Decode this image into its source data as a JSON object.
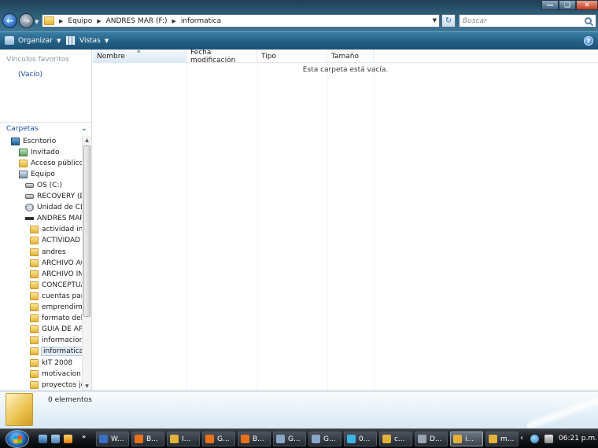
{
  "address": {
    "crumbs": [
      "Equipo",
      "ANDRES MAR (F:)",
      "informatica"
    ],
    "search_placeholder": "Buscar"
  },
  "toolbar": {
    "organize_label": "Organizar",
    "views_label": "Vistas",
    "help_label": "?"
  },
  "navpane": {
    "favorites_header": "Vínculos favoritos",
    "favorites_empty": "(Vacío)",
    "folders_header": "Carpetas",
    "tree": [
      {
        "label": "Escritorio",
        "icon": "desktop-icon"
      },
      {
        "label": "Invitado",
        "icon": "user-folder-icon"
      },
      {
        "label": "Acceso público",
        "icon": "folder-icon"
      },
      {
        "label": "Equipo",
        "icon": "computer-icon"
      },
      {
        "label": "OS (C:)",
        "icon": "drive-icon"
      },
      {
        "label": "RECOVERY (D:)",
        "icon": "drive-icon"
      },
      {
        "label": "Unidad de CD",
        "icon": "cd-drive-icon"
      },
      {
        "label": "ANDRES MAR",
        "icon": "usb-drive-icon"
      },
      {
        "label": "actividad int",
        "icon": "folder-icon"
      },
      {
        "label": "ACTIVIDAD (",
        "icon": "folder-icon"
      },
      {
        "label": "andres",
        "icon": "folder-icon"
      },
      {
        "label": "ARCHIVO AC",
        "icon": "folder-icon"
      },
      {
        "label": "ARCHIVO IN",
        "icon": "folder-icon"
      },
      {
        "label": "CONCEPTUA",
        "icon": "folder-icon"
      },
      {
        "label": "cuentas para",
        "icon": "folder-icon"
      },
      {
        "label": "emprendimi",
        "icon": "folder-icon"
      },
      {
        "label": "formato del",
        "icon": "folder-icon"
      },
      {
        "label": "GUIA DE APR",
        "icon": "folder-icon"
      },
      {
        "label": "informacion_",
        "icon": "folder-icon"
      },
      {
        "label": "informatica",
        "icon": "folder-icon"
      },
      {
        "label": "kIT 2008",
        "icon": "folder-icon"
      },
      {
        "label": "motivacion l",
        "icon": "folder-icon"
      },
      {
        "label": "proyectos jo",
        "icon": "folder-icon"
      }
    ]
  },
  "filelist": {
    "columns": [
      "Nombre",
      "Fecha modificación",
      "Tipo",
      "Tamaño"
    ],
    "empty_message": "Esta carpeta está vacía."
  },
  "details": {
    "item_count": "0 elementos"
  },
  "taskbar": {
    "buttons": [
      {
        "label": "W...",
        "color": "#3b6fc2"
      },
      {
        "label": "B...",
        "color": "#e8711b"
      },
      {
        "label": "I...",
        "color": "#e2b13a"
      },
      {
        "label": "G...",
        "color": "#e8711b"
      },
      {
        "label": "B...",
        "color": "#e8711b"
      },
      {
        "label": "G...",
        "color": "#8aa6c8"
      },
      {
        "label": "G...",
        "color": "#8aa6c8"
      },
      {
        "label": "0...",
        "color": "#3fb3e3"
      },
      {
        "label": "c...",
        "color": "#e2b13a"
      },
      {
        "label": "D...",
        "color": "#9aa4ae"
      },
      {
        "label": "i...",
        "color": "#e2b13a"
      },
      {
        "label": "m...",
        "color": "#e2b13a"
      }
    ],
    "clock": "06:21 p.m."
  }
}
